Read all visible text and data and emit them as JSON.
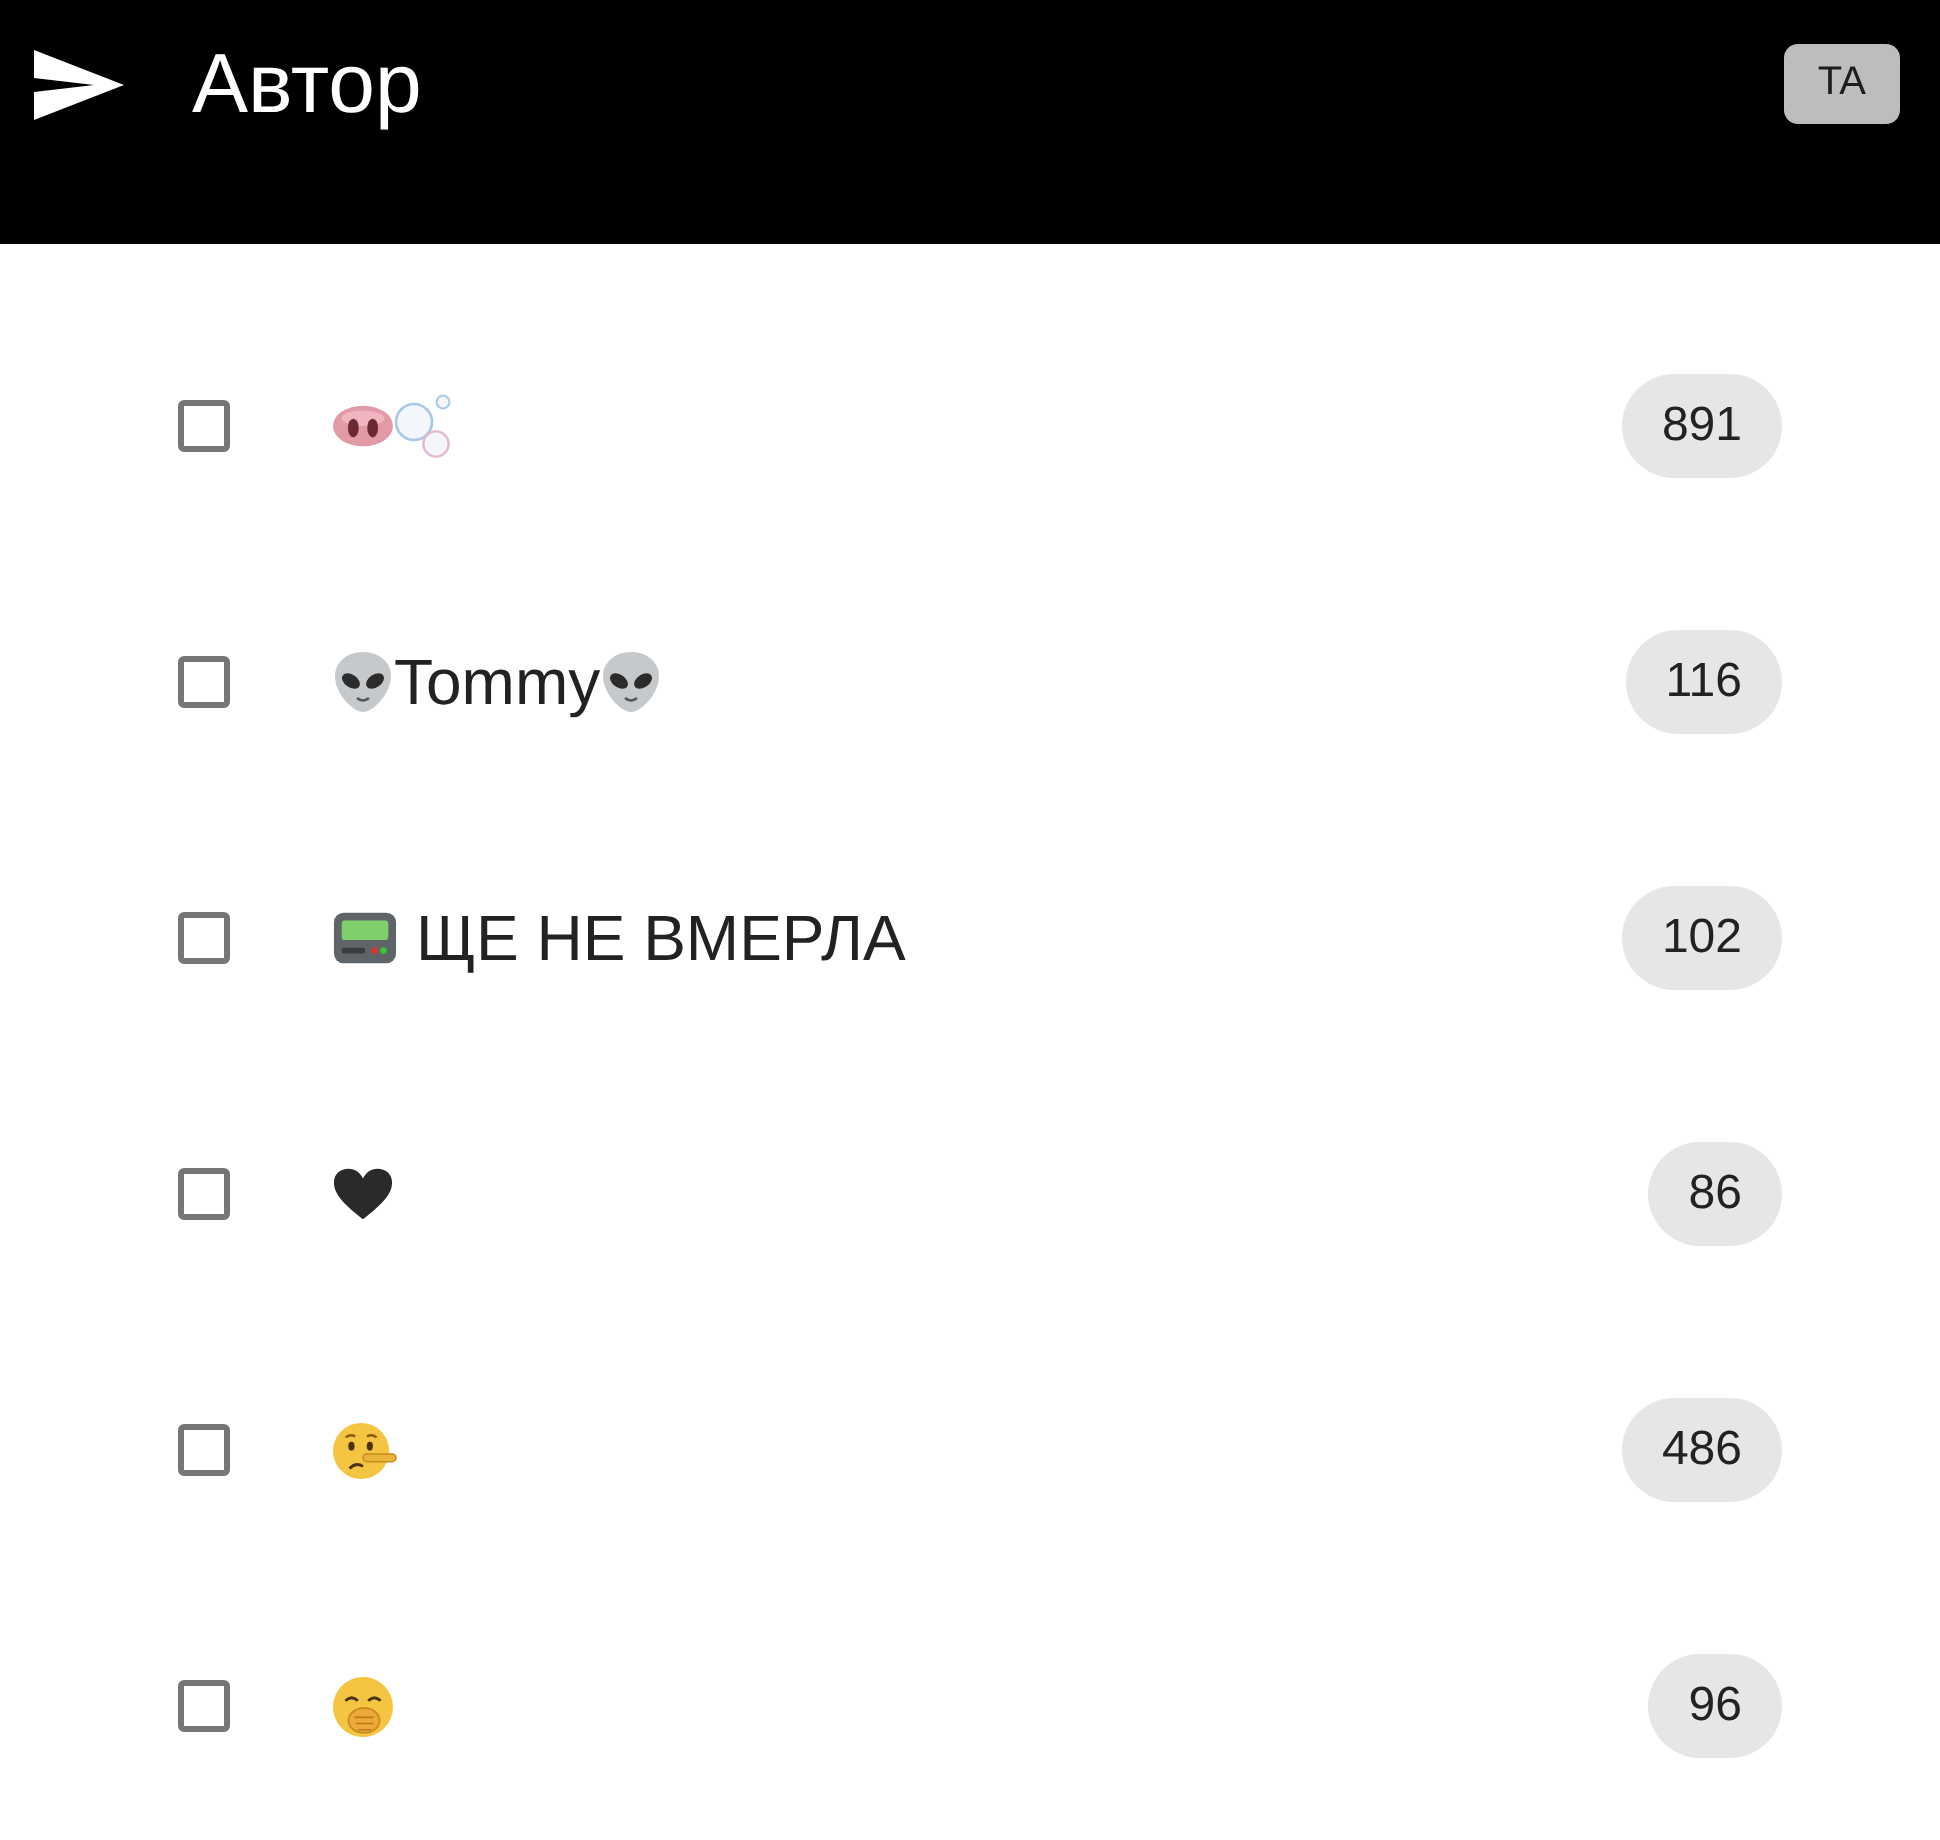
{
  "header": {
    "title": "Автор",
    "avatar": "TA"
  },
  "rows": [
    {
      "checked": false,
      "parts": [
        {
          "kind": "pignose"
        },
        {
          "kind": "bubbles"
        }
      ],
      "count": "891"
    },
    {
      "checked": false,
      "parts": [
        {
          "kind": "alien"
        },
        {
          "kind": "text",
          "text": "Tommy"
        },
        {
          "kind": "alien"
        }
      ],
      "count": "116"
    },
    {
      "checked": false,
      "parts": [
        {
          "kind": "pager"
        },
        {
          "kind": "text",
          "text": "ЩЕ НЕ ВМЕРЛА"
        }
      ],
      "count": "102"
    },
    {
      "checked": false,
      "parts": [
        {
          "kind": "heart"
        }
      ],
      "count": "86"
    },
    {
      "checked": false,
      "parts": [
        {
          "kind": "lying"
        }
      ],
      "count": "486"
    },
    {
      "checked": false,
      "parts": [
        {
          "kind": "yawning"
        }
      ],
      "count": "96"
    }
  ]
}
